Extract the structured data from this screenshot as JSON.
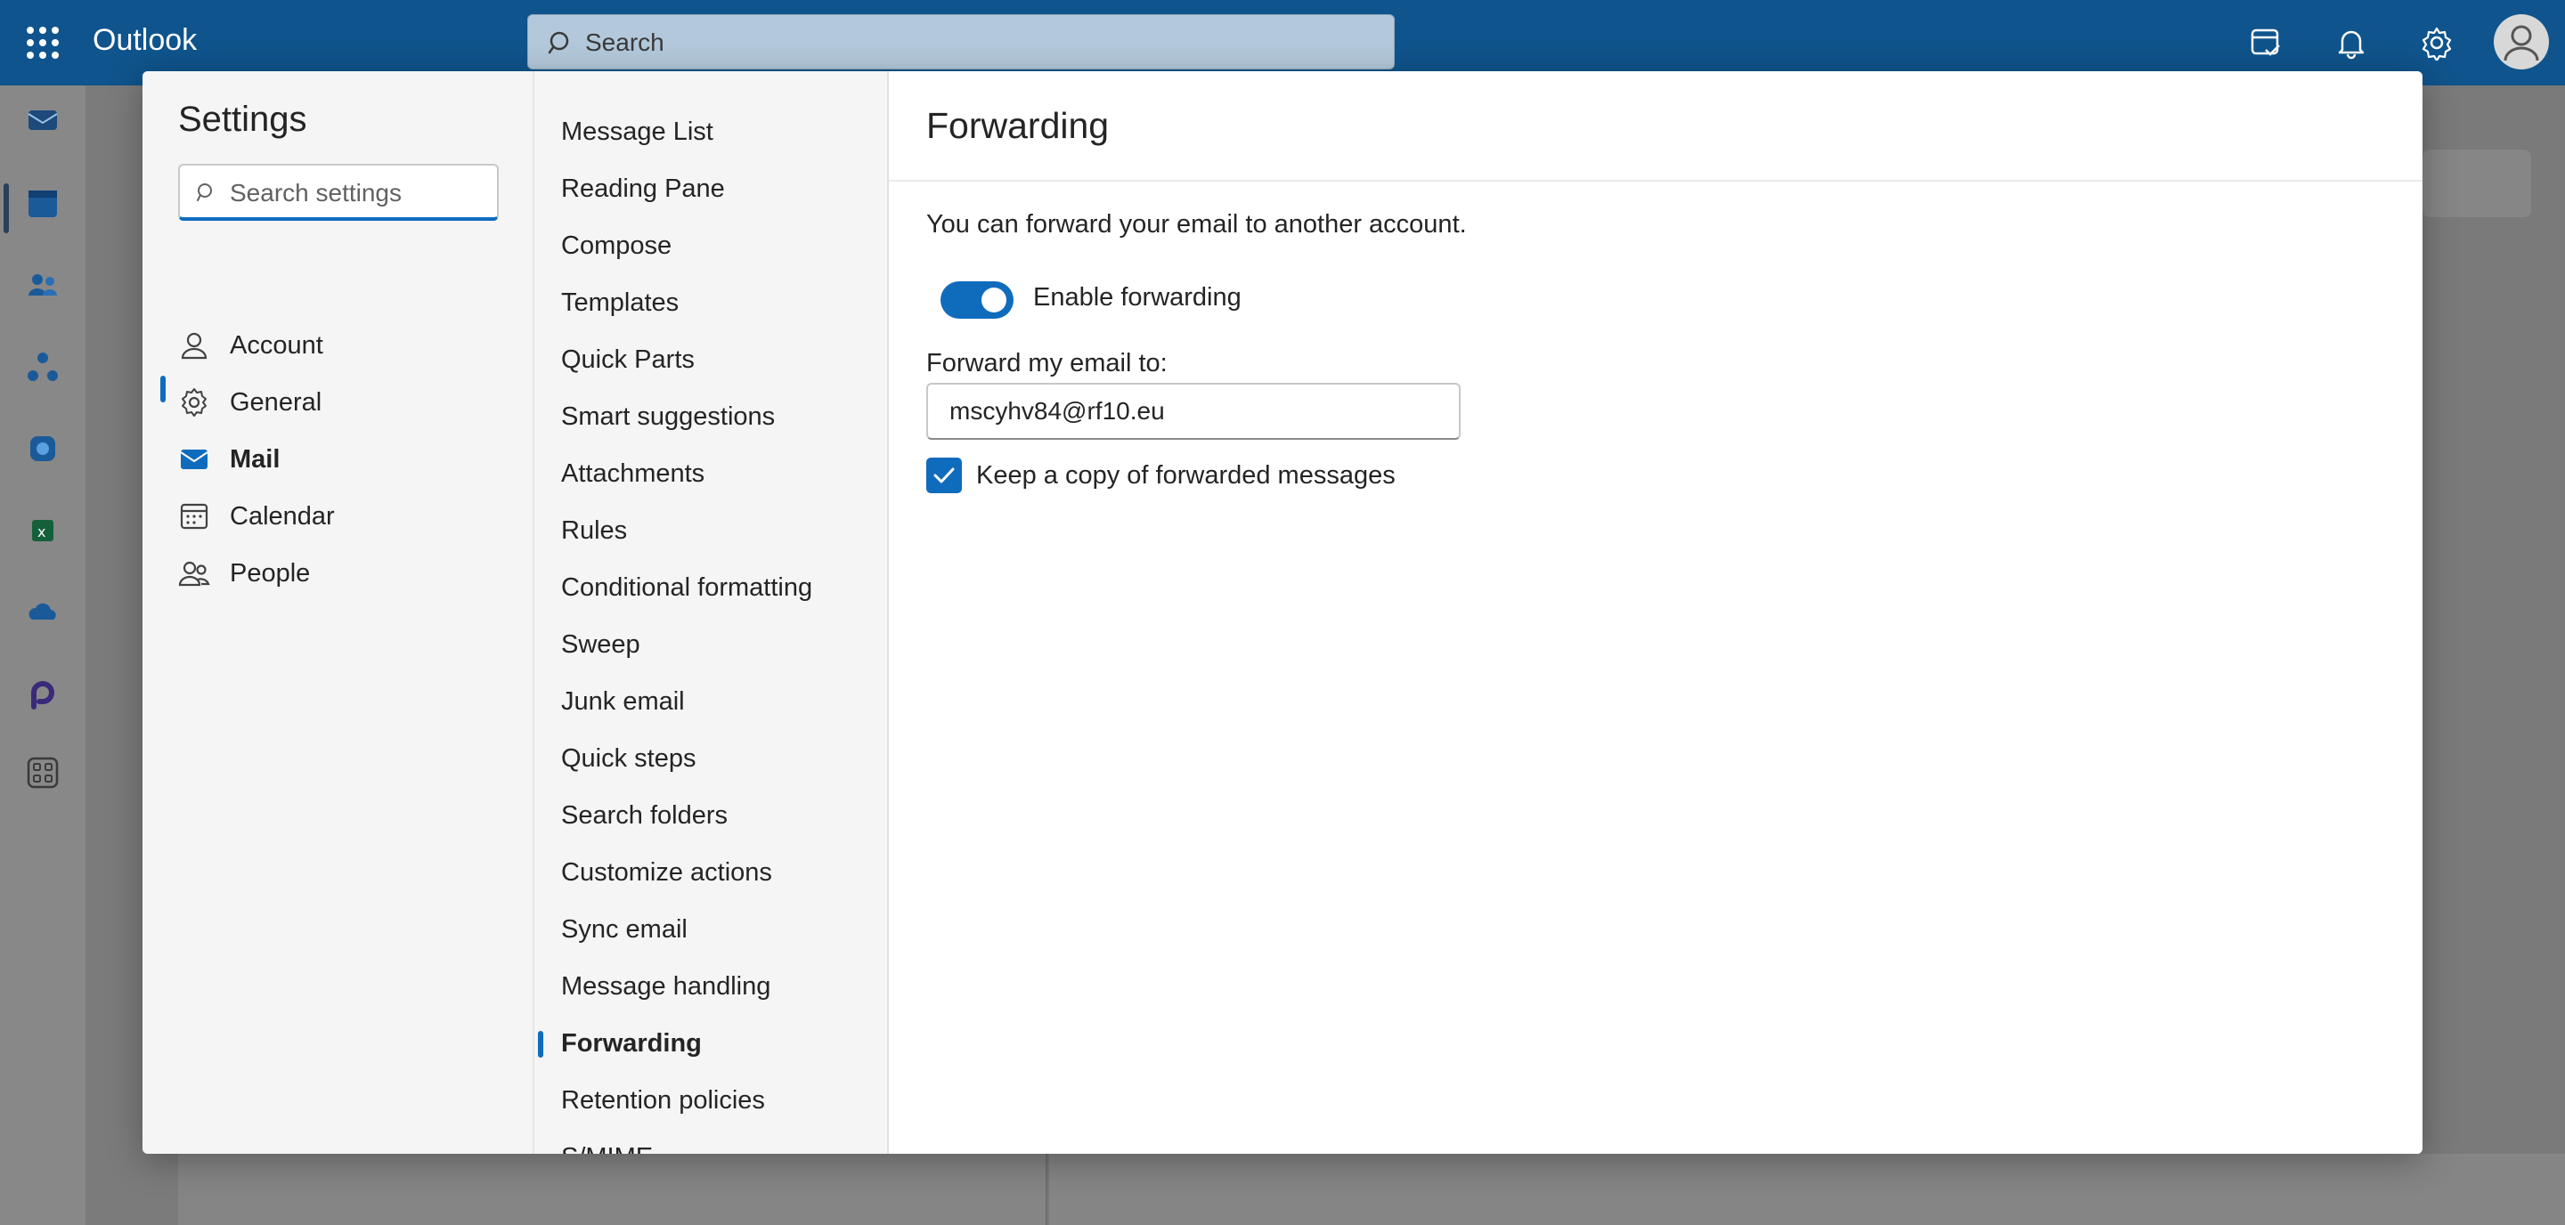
{
  "topbar": {
    "brand": "Outlook",
    "search_placeholder": "Search",
    "icons": [
      "waffle-icon",
      "search-icon",
      "my-day-icon",
      "bell-icon",
      "gear-icon",
      "avatar"
    ]
  },
  "rail": {
    "icons": [
      "mail-icon",
      "calendar-icon",
      "people-icon",
      "org-icon",
      "copilot-icon",
      "excel-icon",
      "onedrive-icon",
      "loop-icon",
      "apps-icon"
    ]
  },
  "settings": {
    "title": "Settings",
    "search_placeholder": "Search settings",
    "categories": [
      {
        "label": "Account",
        "icon": "person-icon"
      },
      {
        "label": "General",
        "icon": "gear-icon"
      },
      {
        "label": "Mail",
        "icon": "mail-icon",
        "active": true
      },
      {
        "label": "Calendar",
        "icon": "calendar-icon"
      },
      {
        "label": "People",
        "icon": "people-icon"
      }
    ],
    "mail_sections": [
      "Message List",
      "Reading Pane",
      "Compose",
      "Templates",
      "Quick Parts",
      "Smart suggestions",
      "Attachments",
      "Rules",
      "Conditional formatting",
      "Sweep",
      "Junk email",
      "Quick steps",
      "Search folders",
      "Customize actions",
      "Sync email",
      "Message handling",
      "Forwarding",
      "Retention policies",
      "S/MIME"
    ],
    "active_section": "Forwarding"
  },
  "forwarding": {
    "title": "Forwarding",
    "description": "You can forward your email to another account.",
    "enable_label": "Enable forwarding",
    "enabled": true,
    "forward_to_label": "Forward my email to:",
    "forward_to_value": "mscyhv84@rf10.eu",
    "keep_copy_label": "Keep a copy of forwarded messages",
    "keep_copy": true
  },
  "colors": {
    "topbar": "#0f548c",
    "accent": "#0f6cbd"
  }
}
